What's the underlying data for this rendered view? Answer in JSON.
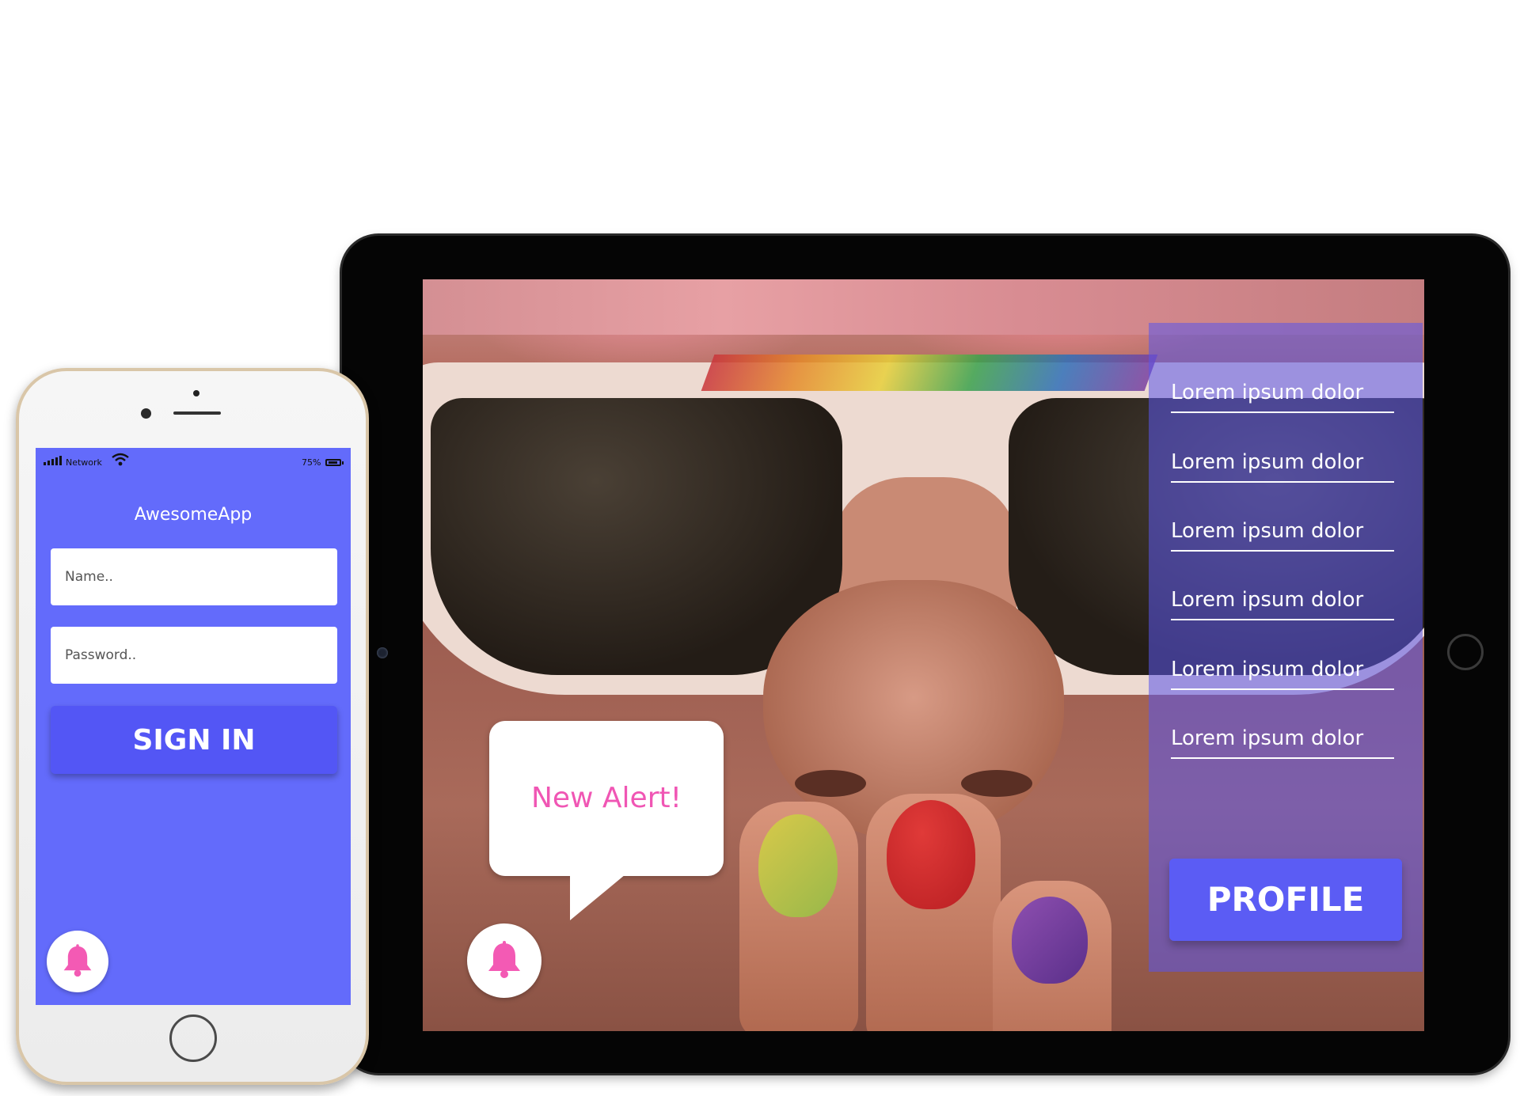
{
  "phone": {
    "status_bar": {
      "network_label": "Network",
      "battery_label": "75%"
    },
    "app_title": "AwesomeApp",
    "name_field": {
      "placeholder": "Name..",
      "value": ""
    },
    "password_field": {
      "placeholder": "Password..",
      "value": ""
    },
    "sign_in_label": "SIGN IN",
    "notification_icon": "bell-icon"
  },
  "tablet": {
    "menu_items": [
      {
        "label": "Lorem ipsum dolor"
      },
      {
        "label": "Lorem ipsum dolor"
      },
      {
        "label": "Lorem ipsum dolor"
      },
      {
        "label": "Lorem ipsum dolor"
      },
      {
        "label": "Lorem ipsum dolor"
      },
      {
        "label": "Lorem ipsum dolor"
      }
    ],
    "profile_label": "PROFILE",
    "alert_text": "New Alert!",
    "notification_icon": "bell-icon"
  },
  "colors": {
    "accent": "#5b5cf4",
    "phone_screen_bg": "#636bfb",
    "alert_text": "#f056b4",
    "bell": "#f35ab4"
  }
}
